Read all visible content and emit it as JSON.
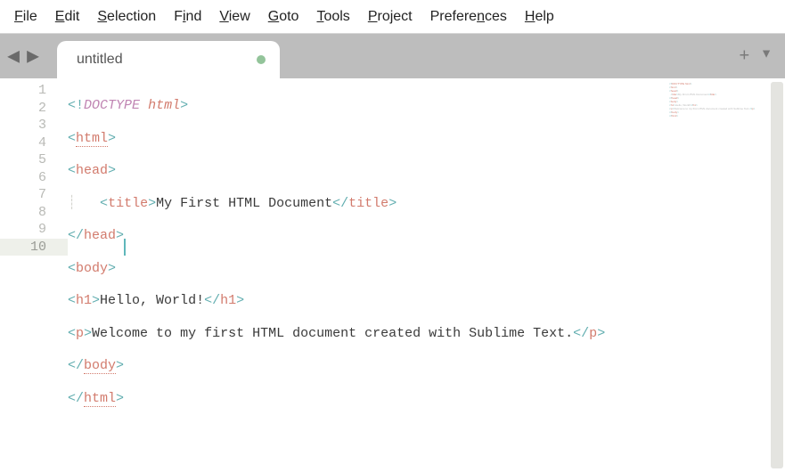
{
  "menu": {
    "file": "File",
    "edit": "Edit",
    "selection": "Selection",
    "find": "Find",
    "view": "View",
    "goto": "Goto",
    "tools": "Tools",
    "project": "Project",
    "preferences": "Preferences",
    "help": "Help"
  },
  "tab": {
    "title": "untitled"
  },
  "lineNumbers": [
    "1",
    "2",
    "3",
    "4",
    "5",
    "6",
    "7",
    "8",
    "9",
    "10"
  ],
  "activeLine": 10,
  "syntax": {
    "lt": "<",
    "gt": ">",
    "sl": "/",
    "bang": "!",
    "doctype": "DOCTYPE",
    "htmlkw": "html",
    "htmlTag": "html",
    "headTag": "head",
    "titleTag": "title",
    "bodyTag": "body",
    "h1Tag": "h1",
    "pTag": "p"
  },
  "content": {
    "titleText": "My First HTML Document",
    "h1Text": "Hello, World!",
    "pText": "Welcome to my first HTML document created with Sublime Text."
  },
  "indentGuide": "┊"
}
